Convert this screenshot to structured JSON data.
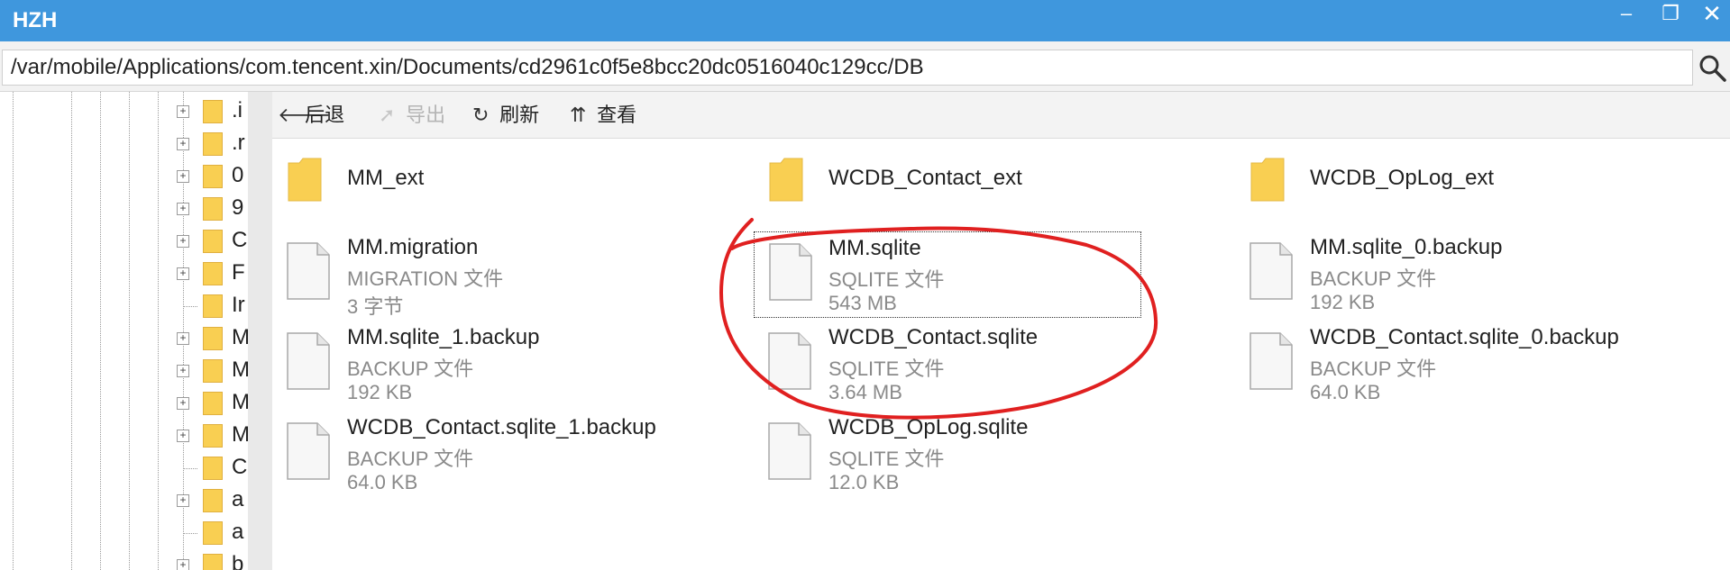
{
  "window": {
    "title": "HZH",
    "minimize": "–",
    "maximize": "❐",
    "close": "✕"
  },
  "address": {
    "path": "/var/mobile/Applications/com.tencent.xin/Documents/cd2961c0f5e8bcc20dc0516040c129cc/DB"
  },
  "tree": {
    "items": [
      {
        "label": ".i",
        "expandable": true
      },
      {
        "label": ".r",
        "expandable": true
      },
      {
        "label": "0",
        "expandable": true
      },
      {
        "label": "9",
        "expandable": true
      },
      {
        "label": "C",
        "expandable": true
      },
      {
        "label": "F",
        "expandable": true
      },
      {
        "label": "Ir",
        "expandable": false
      },
      {
        "label": "M",
        "expandable": true
      },
      {
        "label": "M",
        "expandable": true
      },
      {
        "label": "M",
        "expandable": true
      },
      {
        "label": "M",
        "expandable": true
      },
      {
        "label": "C",
        "expandable": false
      },
      {
        "label": "a",
        "expandable": true
      },
      {
        "label": "a",
        "expandable": false
      },
      {
        "label": "b",
        "expandable": true
      }
    ]
  },
  "toolbar": {
    "back": "后退",
    "export": "导出",
    "refresh": "刷新",
    "view": "查看"
  },
  "folders": [
    {
      "name": "MM_ext"
    },
    {
      "name": "WCDB_Contact_ext"
    },
    {
      "name": "WCDB_OpLog_ext"
    }
  ],
  "files": [
    {
      "name": "MM.migration",
      "type": "MIGRATION 文件",
      "size": "3 字节"
    },
    {
      "name": "MM.sqlite",
      "type": "SQLITE 文件",
      "size": "543 MB",
      "selected": true
    },
    {
      "name": "MM.sqlite_0.backup",
      "type": "BACKUP 文件",
      "size": "192 KB"
    },
    {
      "name": "MM.sqlite_1.backup",
      "type": "BACKUP 文件",
      "size": "192 KB"
    },
    {
      "name": "WCDB_Contact.sqlite",
      "type": "SQLITE 文件",
      "size": "3.64 MB"
    },
    {
      "name": "WCDB_Contact.sqlite_0.backup",
      "type": "BACKUP 文件",
      "size": "64.0 KB"
    },
    {
      "name": "WCDB_Contact.sqlite_1.backup",
      "type": "BACKUP 文件",
      "size": "64.0 KB"
    },
    {
      "name": "WCDB_OpLog.sqlite",
      "type": "SQLITE 文件",
      "size": "12.0 KB"
    }
  ],
  "colors": {
    "titlebar": "#3f97dd",
    "folder": "#f9cf52",
    "annotation": "#e02020"
  }
}
